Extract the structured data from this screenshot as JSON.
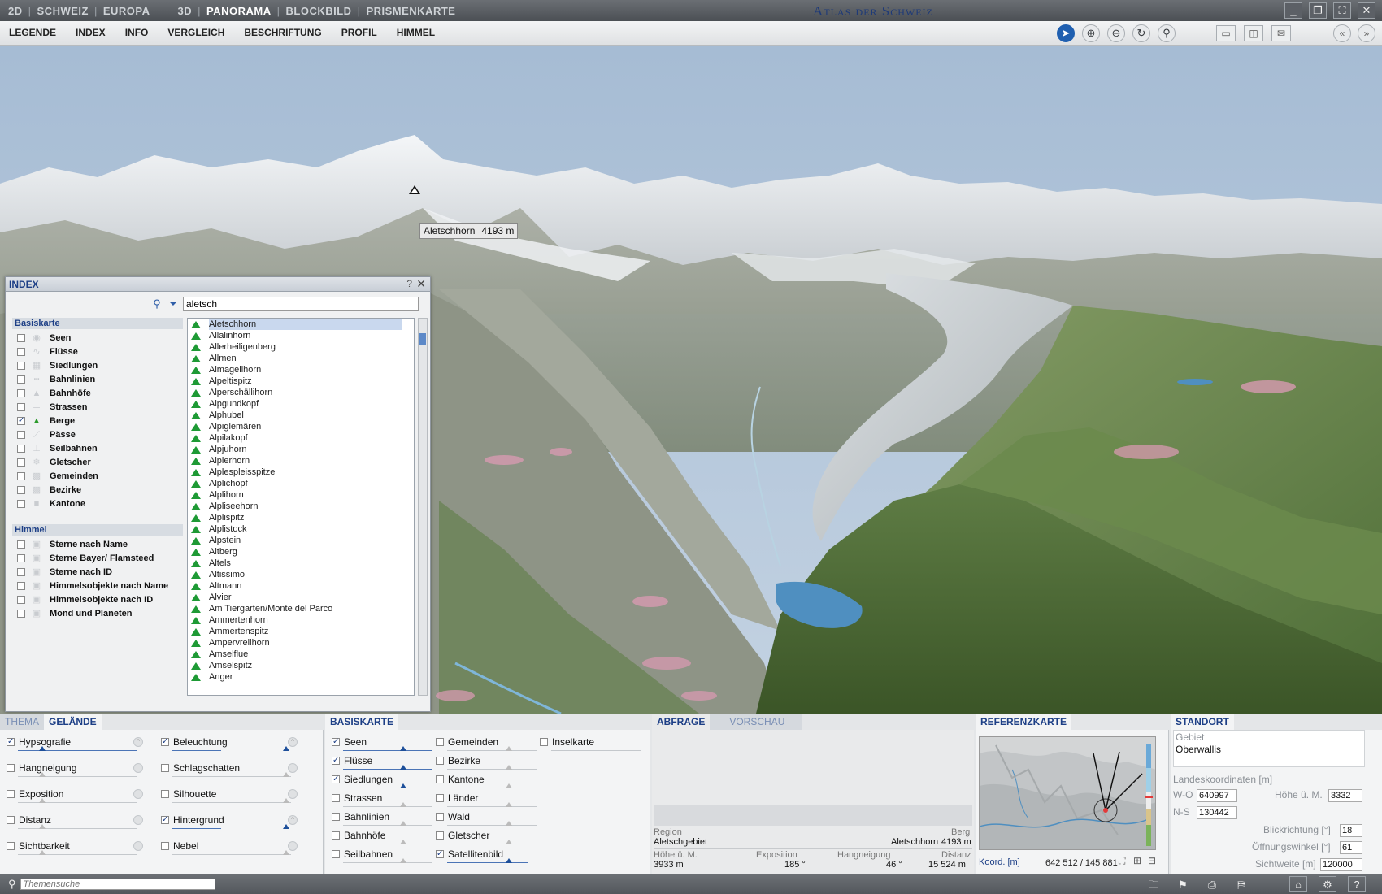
{
  "modebar": {
    "modes_2d": [
      "2D",
      "SCHWEIZ",
      "EUROPA"
    ],
    "modes_3d": [
      "3D",
      "PANORAMA",
      "BLOCKBILD",
      "PRISMENKARTE"
    ],
    "active_mode": "PANORAMA",
    "title": "Atlas der Schweiz"
  },
  "menubar": {
    "items": [
      "LEGENDE",
      "INDEX",
      "INFO",
      "VERGLEICH",
      "BESCHRIFTUNG",
      "PROFIL",
      "HIMMEL"
    ]
  },
  "view": {
    "peak_name": "Aletschhorn",
    "peak_height": "4193 m"
  },
  "index_panel": {
    "title": "INDEX",
    "help": "?",
    "search_value": "aletsch",
    "groups": [
      {
        "name": "Basiskarte",
        "items": [
          {
            "label": "Seen",
            "checked": false
          },
          {
            "label": "Flüsse",
            "checked": false
          },
          {
            "label": "Siedlungen",
            "checked": false
          },
          {
            "label": "Bahnlinien",
            "checked": false
          },
          {
            "label": "Bahnhöfe",
            "checked": false
          },
          {
            "label": "Strassen",
            "checked": false
          },
          {
            "label": "Berge",
            "checked": true
          },
          {
            "label": "Pässe",
            "checked": false
          },
          {
            "label": "Seilbahnen",
            "checked": false
          },
          {
            "label": "Gletscher",
            "checked": false
          },
          {
            "label": "Gemeinden",
            "checked": false
          },
          {
            "label": "Bezirke",
            "checked": false
          },
          {
            "label": "Kantone",
            "checked": false
          }
        ]
      },
      {
        "name": "Himmel",
        "items": [
          {
            "label": "Sterne nach Name",
            "checked": false
          },
          {
            "label": "Sterne Bayer/ Flamsteed",
            "checked": false
          },
          {
            "label": "Sterne nach ID",
            "checked": false
          },
          {
            "label": "Himmelsobjekte nach Name",
            "checked": false
          },
          {
            "label": "Himmelsobjekte nach ID",
            "checked": false
          },
          {
            "label": "Mond und Planeten",
            "checked": false
          }
        ]
      }
    ],
    "results": [
      "Aletschhorn",
      "Allalinhorn",
      "Allerheiligenberg",
      "Allmen",
      "Almagellhorn",
      "Alpeltispitz",
      "Alperschällihorn",
      "Alpgundkopf",
      "Alphubel",
      "Alpiglemären",
      "Alpilakopf",
      "Alpjuhorn",
      "Alplerhorn",
      "Alplespleisspitze",
      "Alplichopf",
      "Alplihorn",
      "Alpliseehorn",
      "Alplispitz",
      "Alplistock",
      "Alpstein",
      "Altberg",
      "Altels",
      "Altissimo",
      "Altmann",
      "Alvier",
      "Am Tiergarten/Monte del Parco",
      "Ammertenhorn",
      "Ammertenspitz",
      "Ampervreilhorn",
      "Amselflue",
      "Amselspitz",
      "Anger"
    ],
    "selected_result": "Aletschhorn"
  },
  "bottom": {
    "tabs_left": [
      "THEMA",
      "GELÄNDE"
    ],
    "active_left": "GELÄNDE",
    "gelaende_col1": [
      {
        "label": "Hypsografie",
        "checked": true
      },
      {
        "label": "Hangneigung",
        "checked": false
      },
      {
        "label": "Exposition",
        "checked": false
      },
      {
        "label": "Distanz",
        "checked": false
      },
      {
        "label": "Sichtbarkeit",
        "checked": false
      }
    ],
    "gelaende_col2": [
      {
        "label": "Beleuchtung",
        "checked": true
      },
      {
        "label": "Schlagschatten",
        "checked": false
      },
      {
        "label": "Silhouette",
        "checked": false
      },
      {
        "label": "Hintergrund",
        "checked": true
      },
      {
        "label": "Nebel",
        "checked": false
      }
    ],
    "basiskarte_tab": "BASISKARTE",
    "basiskarte_col1": [
      {
        "label": "Seen",
        "checked": true
      },
      {
        "label": "Flüsse",
        "checked": true
      },
      {
        "label": "Siedlungen",
        "checked": true
      },
      {
        "label": "Strassen",
        "checked": false
      },
      {
        "label": "Bahnlinien",
        "checked": false
      },
      {
        "label": "Bahnhöfe",
        "checked": false
      },
      {
        "label": "Seilbahnen",
        "checked": false
      }
    ],
    "basiskarte_col2": [
      {
        "label": "Gemeinden",
        "checked": false
      },
      {
        "label": "Bezirke",
        "checked": false
      },
      {
        "label": "Kantone",
        "checked": false
      },
      {
        "label": "Länder",
        "checked": false
      },
      {
        "label": "Wald",
        "checked": false
      },
      {
        "label": "Gletscher",
        "checked": false
      },
      {
        "label": "Satellitenbild",
        "checked": true
      }
    ],
    "basiskarte_col3": [
      {
        "label": "Inselkarte",
        "checked": false
      }
    ],
    "abfrage": {
      "tab": "ABFRAGE",
      "tab2": "VORSCHAU",
      "region_label": "Region",
      "region_value": "Aletschgebiet",
      "berg_label": "Berg",
      "berg_name": "Aletschhorn",
      "berg_height": "4193 m",
      "hoehe_label": "Höhe ü. M.",
      "hoehe_value": "3933 m",
      "exposition_label": "Exposition",
      "exposition_value": "185 °",
      "hangneigung_label": "Hangneigung",
      "hangneigung_value": "46 °",
      "distanz_label": "Distanz",
      "distanz_value": "15 524 m"
    },
    "referenzkarte": {
      "tab": "REFERENZKARTE",
      "koord_label": "Koord. [m]",
      "koord_value": "642 512 / 145 881"
    },
    "standort": {
      "tab": "STANDORT",
      "gebiet_label": "Gebiet",
      "gebiet_value": "Oberwallis",
      "landeskoord_label": "Landeskoordinaten [m]",
      "wo_label": "W-O",
      "wo_value": "640997",
      "ns_label": "N-S",
      "ns_value": "130442",
      "hoehe_label": "Höhe ü. M.",
      "hoehe_value": "3332",
      "blickrichtung_label": "Blickrichtung [°]",
      "blickrichtung_value": "18",
      "oeffnungswinkel_label": "Öffnungswinkel [°]",
      "oeffnungswinkel_value": "61",
      "sichtweite_label": "Sichtweite [m]",
      "sichtweite_value": "120000"
    }
  },
  "statusbar": {
    "search_placeholder": "Themensuche"
  },
  "colors": {
    "accent": "#1d3f86",
    "sky": "#a9bfd6",
    "snow": "#eef1f3",
    "forest": "#56773f",
    "rock": "#8c8f84",
    "lake": "#4f8fc0",
    "settlement": "#d79ab0"
  }
}
